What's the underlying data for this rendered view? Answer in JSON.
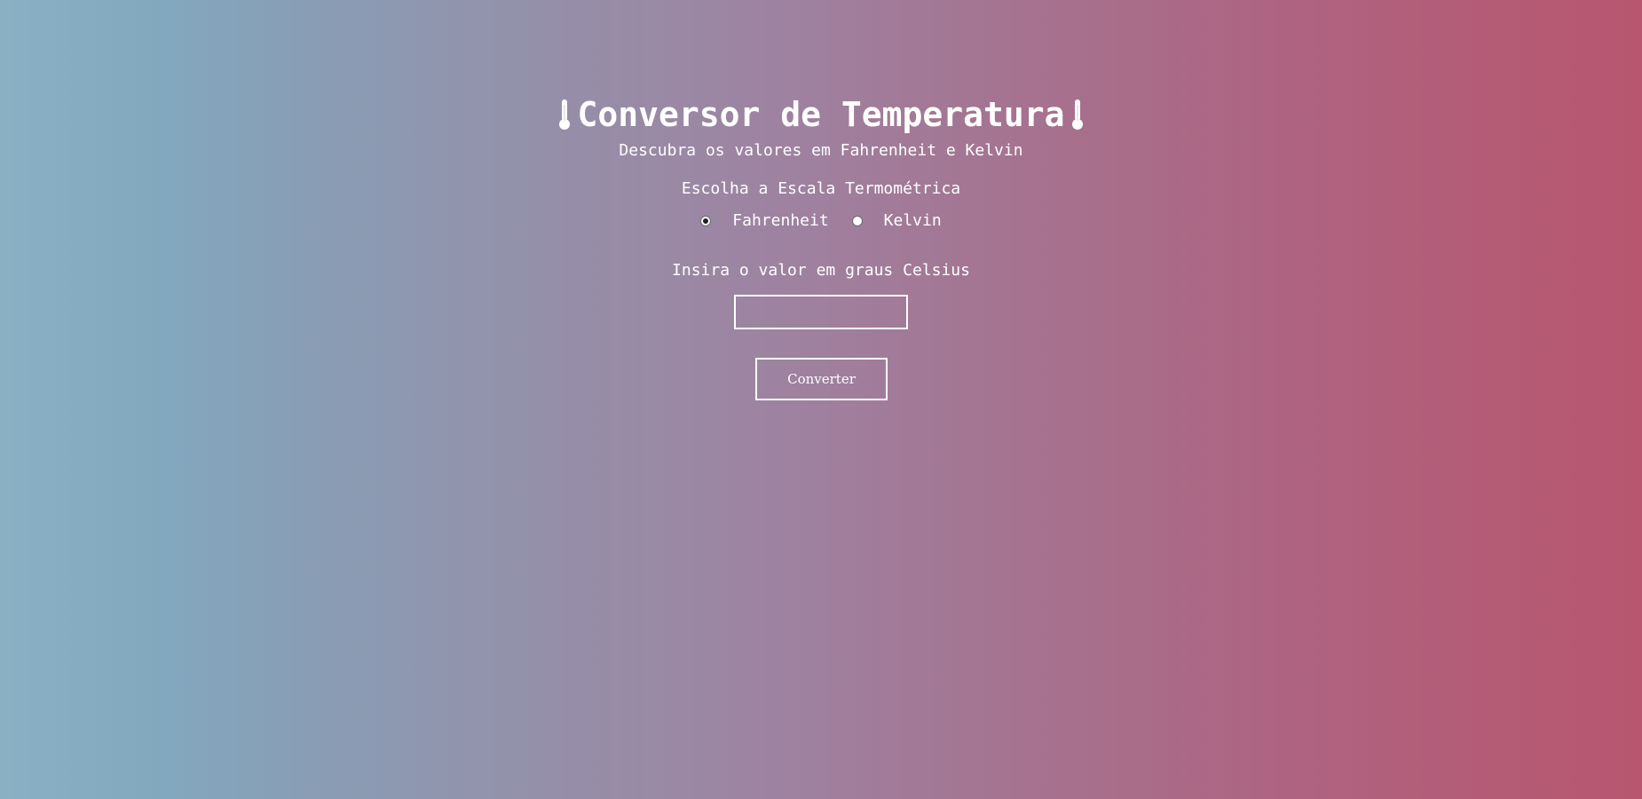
{
  "header": {
    "title": "Conversor de Temperatura",
    "left_icon": "thermometer-icon",
    "right_icon": "thermometer-icon",
    "subtitle": "Descubra os valores em Fahrenheit e Kelvin"
  },
  "scale": {
    "label": "Escolha a Escala Termométrica",
    "options": [
      {
        "label": "Fahrenheit",
        "checked": true
      },
      {
        "label": "Kelvin",
        "checked": false
      }
    ]
  },
  "input": {
    "label": "Insira o valor em graus Celsius",
    "value": "",
    "placeholder": ""
  },
  "actions": {
    "convert_label": "Converter"
  },
  "colors": {
    "gradient_left": "#8ab0c4",
    "gradient_right": "#b8566f",
    "text": "#ffffff"
  }
}
